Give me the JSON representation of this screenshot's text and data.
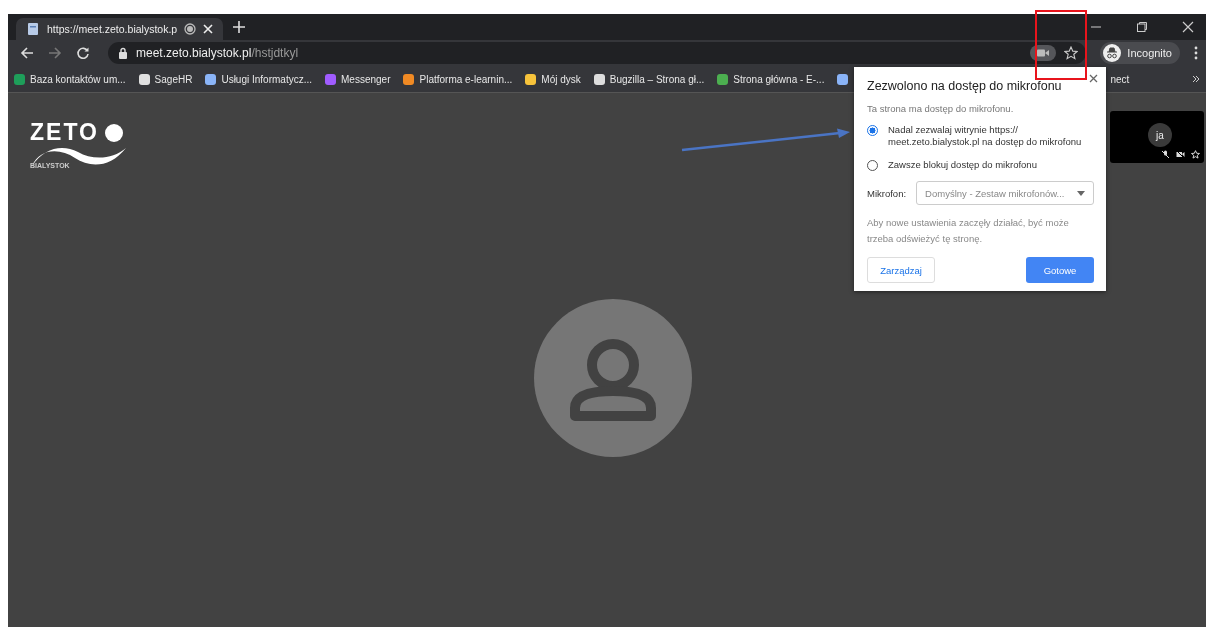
{
  "tabs": [
    {
      "title": "https://meet.zeto.bialystok.p",
      "selected": true,
      "recording": true
    }
  ],
  "address_bar": {
    "host": "meet.zeto.bialystok.pl",
    "path": "/hstjdtkyl"
  },
  "profile": {
    "label": "Incognito"
  },
  "bookmarks": [
    {
      "label": "Baza kontaktów um...",
      "kind": "sheet"
    },
    {
      "label": "SageHR",
      "kind": "sage"
    },
    {
      "label": "Usługi Informatycz...",
      "kind": "page"
    },
    {
      "label": "Messenger",
      "kind": "messenger"
    },
    {
      "label": "Platforma e-learnin...",
      "kind": "learning"
    },
    {
      "label": "Mój dysk",
      "kind": "drive"
    },
    {
      "label": "Bugzilla – Strona gł...",
      "kind": "globe"
    },
    {
      "label": "Strona główna - E-...",
      "kind": "clover"
    },
    {
      "label": "nect",
      "kind": "hidden"
    }
  ],
  "logo": {
    "word": "ZETO",
    "city": "BIALYSTOK"
  },
  "self_view": {
    "initials": "ja"
  },
  "permission_popup": {
    "title": "Zezwolono na dostęp do mikrofonu",
    "subtitle": "Ta strona ma dostęp do mikrofonu.",
    "options": [
      {
        "label": "Nadal zezwalaj witrynie https:// meet.zeto.bialystok.pl na dostęp do mikrofonu",
        "selected": true
      },
      {
        "label": "Zawsze blokuj dostęp do mikrofonu",
        "selected": false
      }
    ],
    "microphone_label": "Mikrofon:",
    "microphone_value": "Domyślny - Zestaw mikrofonów...",
    "note": "Aby nowe ustawienia zaczęły działać, być może trzeba odświeżyć tę stronę.",
    "manage_button": "Zarządzaj",
    "done_button": "Gotowe"
  }
}
